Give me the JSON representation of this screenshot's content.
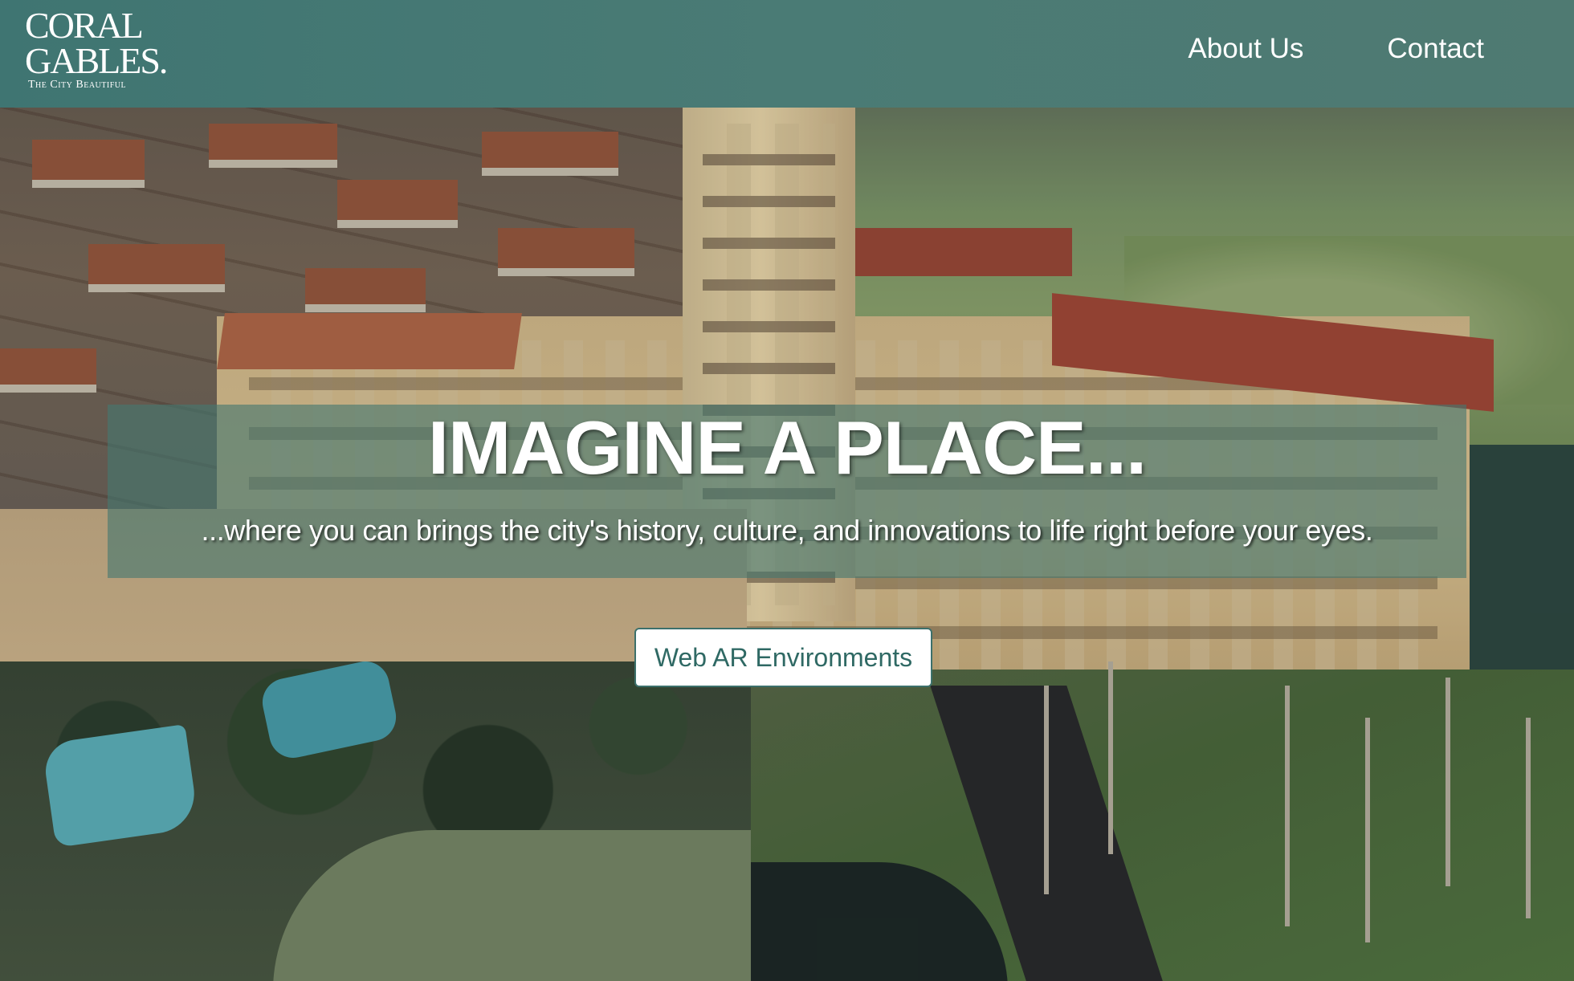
{
  "header": {
    "logo": {
      "line1": "CORAL",
      "line2": "GABLES.",
      "tagline": "The City Beautiful"
    },
    "nav": [
      {
        "label": "About Us"
      },
      {
        "label": "Contact"
      }
    ]
  },
  "hero": {
    "title": "IMAGINE A PLACE...",
    "subtitle": "...where you can brings the city's history, culture, and innovations to life right before your eyes.",
    "cta_label": "Web AR Environments",
    "background_description_icon": "aerial-photo-image"
  },
  "colors": {
    "header_bg": "#457773",
    "banner_bg": "#46786f",
    "button_text": "#2f6964",
    "button_bg": "#ffffff"
  }
}
